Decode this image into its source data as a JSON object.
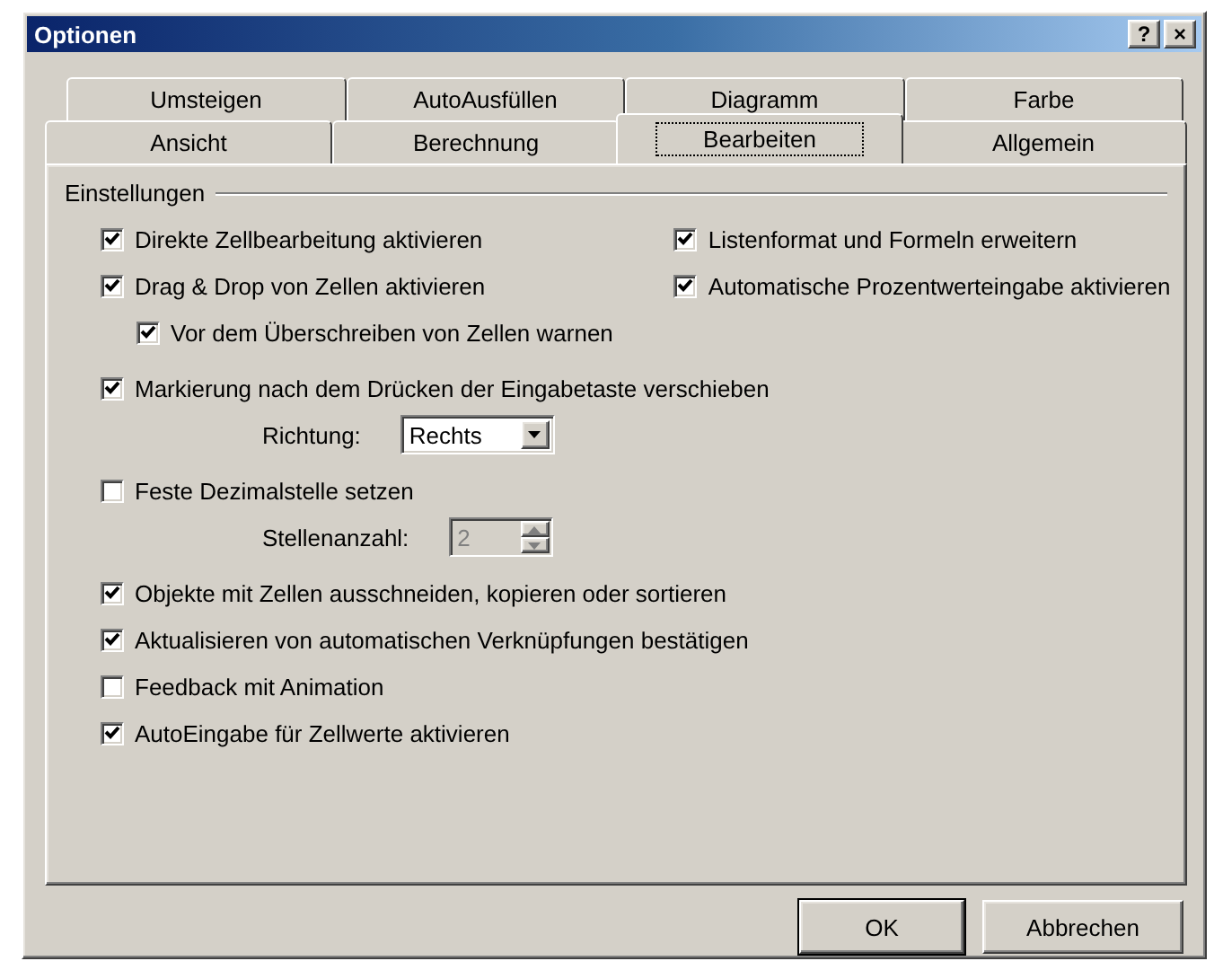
{
  "window": {
    "title": "Optionen",
    "buttons": [
      "?",
      "×"
    ]
  },
  "tab_rows": [
    [
      {
        "label": "Umsteigen",
        "selected": false
      },
      {
        "label": "AutoAusfüllen",
        "selected": false
      },
      {
        "label": "Diagramm",
        "selected": false
      },
      {
        "label": "Farbe",
        "selected": false
      }
    ],
    [
      {
        "label": "Ansicht",
        "selected": false
      },
      {
        "label": "Berechnung",
        "selected": false
      },
      {
        "label": "Bearbeiten",
        "selected": true
      },
      {
        "label": "Allgemein",
        "selected": false
      }
    ]
  ],
  "group": {
    "title": "Einstellungen",
    "sections": [
      {
        "columns": [
          [
            {
              "kind": "checkbox",
              "label": "Direkte Zellbearbeitung aktivieren",
              "checked": true
            },
            {
              "kind": "checkbox",
              "label": "Drag & Drop von Zellen aktivieren",
              "checked": true,
              "children": [
                {
                  "kind": "checkbox",
                  "label": "Vor dem Überschreiben von Zellen warnen",
                  "checked": true
                }
              ]
            }
          ],
          [
            {
              "kind": "checkbox",
              "label": "Listenformat und Formeln erweitern",
              "checked": true
            },
            {
              "kind": "checkbox",
              "label": "Automatische Prozentwerteingabe aktivieren",
              "checked": true
            }
          ]
        ]
      },
      {
        "columns": [
          [
            {
              "kind": "checkbox",
              "label": "Markierung nach dem Drücken der Eingabetaste verschieben",
              "checked": true,
              "children": [
                {
                  "kind": "select",
                  "label": "Richtung:",
                  "value": "Rechts"
                }
              ]
            }
          ]
        ]
      },
      {
        "columns": [
          [
            {
              "kind": "checkbox",
              "label": "Feste Dezimalstelle setzen",
              "checked": false,
              "children": [
                {
                  "kind": "spinner",
                  "label": "Stellenanzahl:",
                  "value": "2",
                  "disabled": true
                }
              ]
            }
          ]
        ]
      },
      {
        "columns": [
          [
            {
              "kind": "checkbox",
              "label": "Objekte mit Zellen ausschneiden, kopieren oder sortieren",
              "checked": true
            },
            {
              "kind": "checkbox",
              "label": "Aktualisieren von automatischen Verknüpfungen bestätigen",
              "checked": true
            },
            {
              "kind": "checkbox",
              "label": "Feedback mit Animation",
              "checked": false
            },
            {
              "kind": "checkbox",
              "label": "AutoEingabe für Zellwerte aktivieren",
              "checked": true
            }
          ]
        ]
      }
    ]
  },
  "buttons": [
    {
      "label": "OK",
      "kind": "default"
    },
    {
      "label": "Abbrechen",
      "kind": "normal"
    }
  ]
}
